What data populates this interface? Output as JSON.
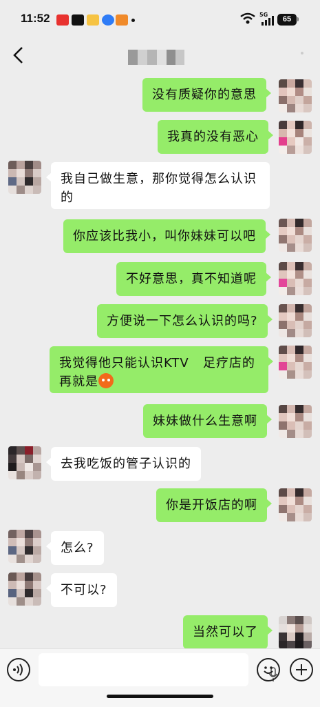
{
  "status_bar": {
    "time": "11:52",
    "network": "5G",
    "battery": "65",
    "app_icons": [
      "toutiao-icon",
      "tiktok-icon",
      "photo-app-icon",
      "browser-icon",
      "game-icon"
    ]
  },
  "nav": {
    "back_icon": "chevron-left-icon",
    "contact_name_obscured": true
  },
  "messages": [
    {
      "sender": "me",
      "text": "没有质疑你的意思"
    },
    {
      "sender": "me",
      "text": "我真的没有恶心"
    },
    {
      "sender": "other",
      "lines": [
        "我自己做生意，那你觉得怎么认识",
        "的"
      ]
    },
    {
      "sender": "me",
      "text": "你应该比我小，叫你妹妹可以吧"
    },
    {
      "sender": "me",
      "text": "不好意思，真不知道呢"
    },
    {
      "sender": "me",
      "text": "方便说一下怎么认识的吗?"
    },
    {
      "sender": "me",
      "lines": [
        "我觉得他只能认识KTV   足疗店的",
        "再就是"
      ],
      "emoji": "emoji-face-icon"
    },
    {
      "sender": "me",
      "text": "妹妹做什么生意啊"
    },
    {
      "sender": "other",
      "text": "去我吃饭的管子认识的"
    },
    {
      "sender": "me",
      "text": "你是开饭店的啊"
    },
    {
      "sender": "other",
      "text": "怎么?"
    },
    {
      "sender": "other",
      "text": "不可以?"
    },
    {
      "sender": "me",
      "text": "当然可以了"
    }
  ],
  "input_bar": {
    "voice_icon": "voice-input-icon",
    "mic_icon": "microphone-icon",
    "emoji_icon": "emoji-icon",
    "plus_icon": "plus-icon"
  },
  "colors": {
    "background": "#ededed",
    "my_bubble": "#95ec69",
    "other_bubble": "#ffffff"
  }
}
